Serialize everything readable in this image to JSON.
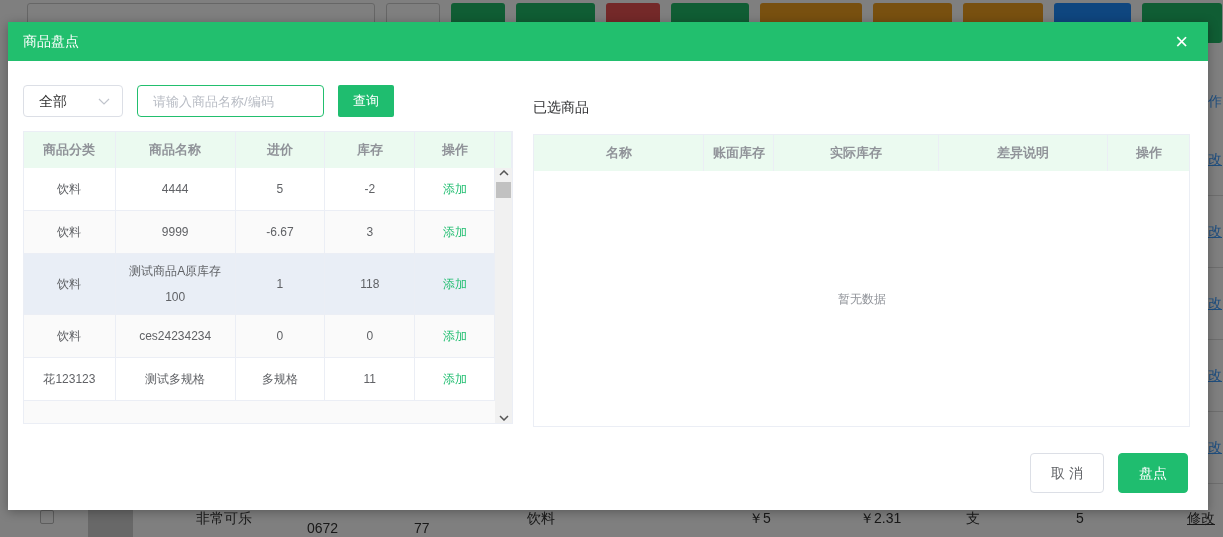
{
  "background": {
    "toolbar": [
      {
        "kind": "default"
      },
      {
        "kind": "success"
      },
      {
        "kind": "success"
      },
      {
        "kind": "danger"
      },
      {
        "kind": "success"
      },
      {
        "kind": "warning"
      },
      {
        "kind": "warning"
      },
      {
        "kind": "warning"
      },
      {
        "kind": "primary"
      },
      {
        "kind": "success"
      }
    ],
    "table": {
      "header": "作",
      "rows": [
        {
          "action": "改"
        },
        {
          "action": "改"
        },
        {
          "action": "改"
        },
        {
          "action": "改"
        },
        {
          "action": "改"
        }
      ],
      "last_row": {
        "checked": false,
        "name": "非常可乐",
        "barcode": "0672",
        "code": "77",
        "category": "饮料",
        "price": "￥5",
        "cost": "￥2.31",
        "unit": "支",
        "stock": "5",
        "action": "修改"
      }
    }
  },
  "dialog": {
    "title": "商品盘点",
    "close": "×",
    "filter": {
      "category": "全部",
      "search": {
        "placeholder": "请输入商品名称/编码"
      },
      "button": "查询"
    },
    "goods_table": {
      "columns": [
        "商品分类",
        "商品名称",
        "进价",
        "库存",
        "操作"
      ],
      "rows": [
        {
          "category": "饮料",
          "name": "4444",
          "price": "5",
          "stock": "-2",
          "action": "添加",
          "highlighted": false
        },
        {
          "category": "饮料",
          "name": "9999",
          "price": "-6.67",
          "stock": "3",
          "action": "添加",
          "highlighted": false
        },
        {
          "category": "饮料",
          "name": "测试商品A原库存100",
          "price": "1",
          "stock": "118",
          "action": "添加",
          "highlighted": true
        },
        {
          "category": "饮料",
          "name": "ces24234234",
          "price": "0",
          "stock": "0",
          "action": "添加",
          "highlighted": false
        },
        {
          "category": "花123123",
          "name": "测试多规格",
          "price": "多规格",
          "stock": "11",
          "action": "添加",
          "highlighted": false
        }
      ]
    },
    "selected": {
      "title": "已选商品",
      "columns": [
        "名称",
        "账面库存",
        "实际库存",
        "差异说明",
        "操作"
      ],
      "empty_text": "暂无数据"
    },
    "buttons": [
      {
        "label": "取 消",
        "kind": "default"
      },
      {
        "label": "盘点",
        "kind": "primary"
      }
    ]
  }
}
